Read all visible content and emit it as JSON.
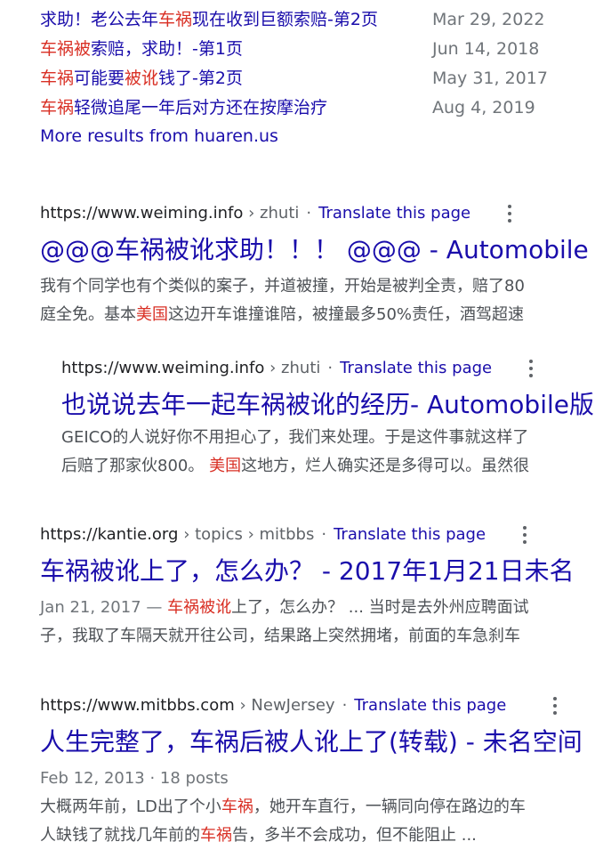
{
  "subresults": [
    {
      "parts": [
        {
          "t": "求助！老公去年",
          "h": false
        },
        {
          "t": "车祸",
          "h": true
        },
        {
          "t": "现在收到巨额索赔-第2页",
          "h": false
        }
      ],
      "date": "Mar 29, 2022"
    },
    {
      "parts": [
        {
          "t": "车祸",
          "h": true
        },
        {
          "t": "被",
          "h": true
        },
        {
          "t": "索赔，求助！-第1页",
          "h": false
        }
      ],
      "date": "Jun 14, 2018"
    },
    {
      "parts": [
        {
          "t": "车祸",
          "h": true
        },
        {
          "t": "可能要",
          "h": false
        },
        {
          "t": "被讹",
          "h": true
        },
        {
          "t": "钱了-第2页",
          "h": false
        }
      ],
      "date": "May 31, 2017"
    },
    {
      "parts": [
        {
          "t": "车祸",
          "h": true
        },
        {
          "t": "轻微追尾一年后对方还在按摩治疗",
          "h": false
        }
      ],
      "date": "Aug 4, 2019"
    }
  ],
  "more_results": "More results from huaren.us",
  "results": [
    {
      "site": "https://www.weiming.info",
      "path": "› zhuti",
      "translate": "Translate this page",
      "title": "@@@车祸被讹求助！！！ @@@ - Automobile",
      "snippet1": [
        {
          "t": "我有个同学也有个类似的案子，并道被撞，开始是被判全责，赔了80",
          "h": false
        }
      ],
      "snippet2": [
        {
          "t": "庭全免。基本",
          "h": false
        },
        {
          "t": "美国",
          "h": true
        },
        {
          "t": "这边开车谁撞谁陪，被撞最多50%责任，酒驾超速",
          "h": false
        }
      ]
    },
    {
      "site": "https://www.weiming.info",
      "path": "› zhuti",
      "translate": "Translate this page",
      "title": "也说说去年一起车祸被讹的经历- Automobile版",
      "snippet1": [
        {
          "t": "GEICO的人说好你不用担心了，我们来处理。于是这件事就这样了",
          "h": false
        }
      ],
      "snippet2": [
        {
          "t": "后赔了那家伙800。 ",
          "h": false
        },
        {
          "t": "美国",
          "h": true
        },
        {
          "t": "这地方，烂人确实还是多得可以。虽然很",
          "h": false
        }
      ]
    },
    {
      "site": "https://kantie.org",
      "path": "› topics › mitbbs",
      "translate": "Translate this page",
      "title": "车祸被讹上了，怎么办？ - 2017年1月21日未名",
      "snippet1": [
        {
          "t": "Jan 21, 2017 — ",
          "h": false,
          "m": true
        },
        {
          "t": "车祸被讹",
          "h": true
        },
        {
          "t": "上了，怎么办？ ... 当时是去外州应聘面试",
          "h": false
        }
      ],
      "snippet2": [
        {
          "t": "子，我取了车隔天就开往公司，结果路上突然拥堵，前面的车急刹车",
          "h": false
        }
      ]
    },
    {
      "site": "https://www.mitbbs.com",
      "path": "› NewJersey",
      "translate": "Translate this page",
      "title": "人生完整了，车祸后被人讹上了(转载) - 未名空间",
      "meta": "Feb 12, 2013 · 18 posts",
      "snippet1": [
        {
          "t": "大概两年前，LD出了个小",
          "h": false
        },
        {
          "t": "车祸",
          "h": true
        },
        {
          "t": "，她开车直行，一辆同向停在路边的车",
          "h": false
        }
      ],
      "snippet2": [
        {
          "t": "人缺钱了就找几年前的",
          "h": false
        },
        {
          "t": "车祸",
          "h": true
        },
        {
          "t": "告，多半不会成功，但不能阻止 ...",
          "h": false
        }
      ]
    }
  ]
}
